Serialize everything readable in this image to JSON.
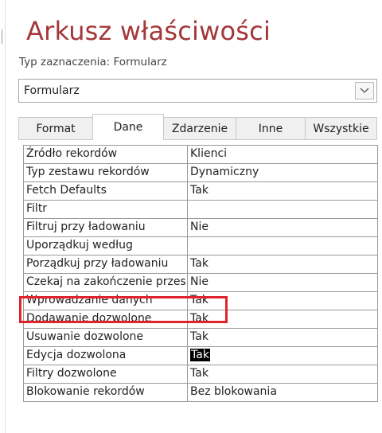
{
  "panel": {
    "title": "Arkusz właściwości",
    "selection_type": "Typ zaznaczenia: Formularz",
    "object_combo": {
      "value": "Formularz",
      "icon": "chevron-down-icon"
    }
  },
  "tabs": [
    {
      "label": "Format",
      "active": false
    },
    {
      "label": "Dane",
      "active": true
    },
    {
      "label": "Zdarzenie",
      "active": false
    },
    {
      "label": "Inne",
      "active": false
    },
    {
      "label": "Wszystkie",
      "active": false
    }
  ],
  "properties": [
    {
      "name": "Źródło rekordów",
      "value": "Klienci"
    },
    {
      "name": "Typ zestawu rekordów",
      "value": "Dynamiczny"
    },
    {
      "name": "Fetch Defaults",
      "value": "Tak"
    },
    {
      "name": "Filtr",
      "value": ""
    },
    {
      "name": "Filtruj przy ładowaniu",
      "value": "Nie"
    },
    {
      "name": "Uporządkuj według",
      "value": ""
    },
    {
      "name": "Porządkuj przy ładowaniu",
      "value": "Tak"
    },
    {
      "name": "Czekaj na zakończenie przes",
      "value": "Nie"
    },
    {
      "name": "Wprowadzanie danych",
      "value": "Tak"
    },
    {
      "name": "Dodawanie dozwolone",
      "value": "Tak"
    },
    {
      "name": "Usuwanie dozwolone",
      "value": "Tak"
    },
    {
      "name": "Edycja dozwolona",
      "value": "Tak",
      "selected": true
    },
    {
      "name": "Filtry dozwolone",
      "value": "Tak"
    },
    {
      "name": "Blokowanie rekordów",
      "value": "Bez blokowania"
    }
  ],
  "colors": {
    "title": "#a4373a",
    "highlight": "#e0242b",
    "selection": "#000000"
  }
}
